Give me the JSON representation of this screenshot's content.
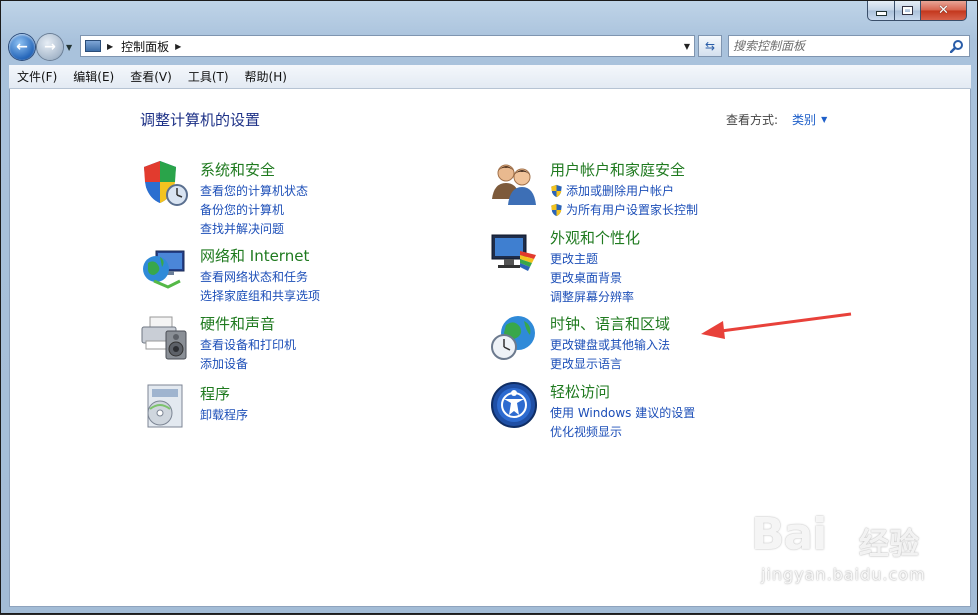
{
  "window": {
    "caption": {
      "minimize": "",
      "maximize": "",
      "close": "✕"
    }
  },
  "nav": {
    "address": {
      "location": "控制面板"
    },
    "search": {
      "placeholder": "搜索控制面板"
    }
  },
  "menu": [
    {
      "label": "文件(F)"
    },
    {
      "label": "编辑(E)"
    },
    {
      "label": "查看(V)"
    },
    {
      "label": "工具(T)"
    },
    {
      "label": "帮助(H)"
    }
  ],
  "page": {
    "title": "调整计算机的设置",
    "view_by_label": "查看方式:",
    "view_by_value": "类别"
  },
  "categories": [
    {
      "title": "系统和安全",
      "icon": "shield-clock-icon",
      "links": [
        "查看您的计算机状态",
        "备份您的计算机",
        "查找并解决问题"
      ]
    },
    {
      "title": "网络和 Internet",
      "icon": "globe-network-icon",
      "links": [
        "查看网络状态和任务",
        "选择家庭组和共享选项"
      ]
    },
    {
      "title": "硬件和声音",
      "icon": "printer-speaker-icon",
      "links": [
        "查看设备和打印机",
        "添加设备"
      ]
    },
    {
      "title": "程序",
      "icon": "programs-disc-icon",
      "links": [
        "卸载程序"
      ]
    },
    {
      "title": "用户帐户和家庭安全",
      "icon": "users-icon",
      "links": [
        "添加或删除用户帐户",
        "为所有用户设置家长控制"
      ]
    },
    {
      "title": "外观和个性化",
      "icon": "monitor-palette-icon",
      "links": [
        "更改主题",
        "更改桌面背景",
        "调整屏幕分辨率"
      ]
    },
    {
      "title": "时钟、语言和区域",
      "icon": "globe-clock-icon",
      "links": [
        "更改键盘或其他输入法",
        "更改显示语言"
      ]
    },
    {
      "title": "轻松访问",
      "icon": "accessibility-icon",
      "links": [
        "使用 Windows 建议的设置",
        "优化视频显示"
      ]
    }
  ],
  "colors": {
    "category_title": "#1f7a1f",
    "link": "#1d4fb8",
    "page_title": "#1e3287",
    "annotation_arrow": "#e8413a"
  },
  "watermark": {
    "brand": "Bai",
    "brand_zh": "经验",
    "url": "jingyan.baidu.com"
  }
}
